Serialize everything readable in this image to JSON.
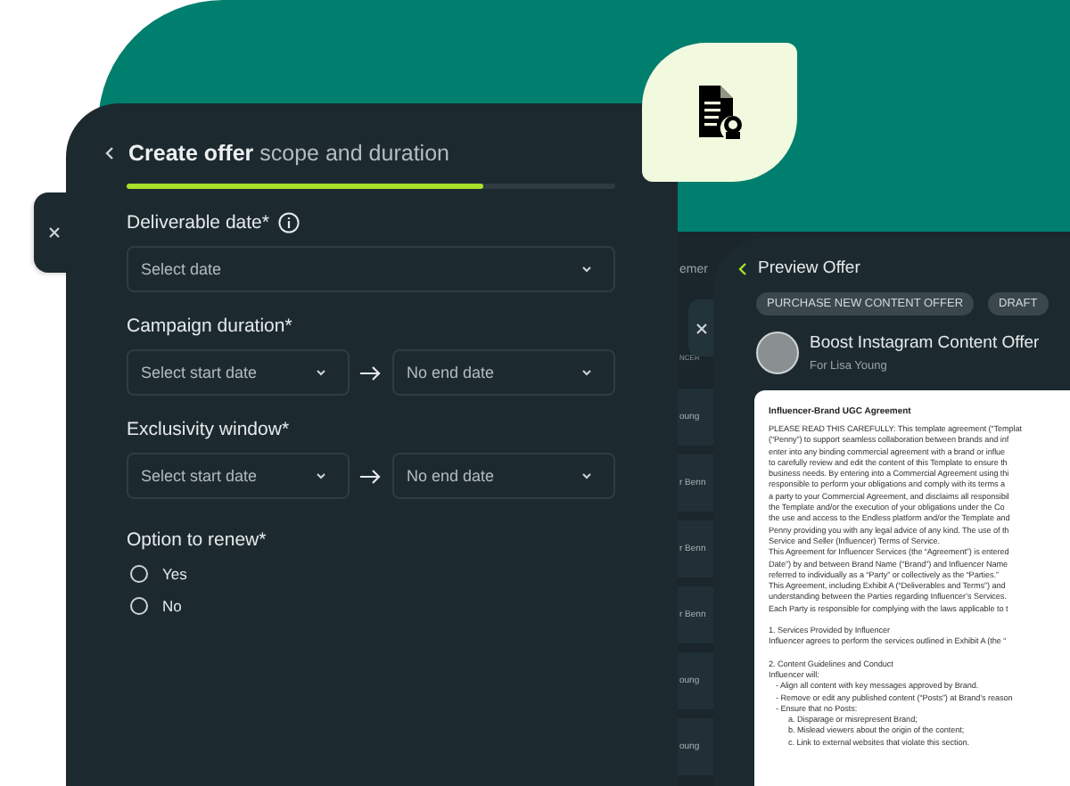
{
  "back_list": {
    "header": "emer",
    "column": "NCER",
    "rows": [
      "oung",
      "r Benn",
      "r Benn",
      "r Benn",
      "oung",
      "oung"
    ]
  },
  "form": {
    "title": "**Create offer** scope and duration",
    "progress": {
      "level": 0.73
    },
    "fields": [
      {
        "kind": "single",
        "label": "Deliverable date*",
        "info": true,
        "placeholder": "Select date"
      },
      {
        "kind": "range",
        "label": "Campaign duration*",
        "info": false,
        "start_placeholder": "Select start date",
        "end_placeholder": "No end date"
      },
      {
        "kind": "range",
        "label": "Exclusivity window*",
        "info": false,
        "start_placeholder": "Select start date",
        "end_placeholder": "No end date"
      }
    ],
    "renew": {
      "label": "Option to renew*",
      "options": [
        {
          "label": "Yes",
          "selected": false
        },
        {
          "label": "No",
          "selected": false
        }
      ]
    }
  },
  "preview": {
    "title": "Preview Offer",
    "tags": [
      "PURCHASE NEW CONTENT OFFER",
      "DRAFT"
    ],
    "offer_title": "Boost Instagram Content Offer",
    "offer_for": "For Lisa Young",
    "document": {
      "title": "Influencer-Brand UGC Agreement",
      "lines": [
        {
          "kind": "line",
          "text": "PLEASE READ THIS CAREFULLY: This template agreement (“Templat"
        },
        {
          "kind": "line",
          "text": "(“Penny”) to support seamless collaboration between brands and inf"
        },
        {
          "kind": "line",
          "text": "enter into any binding commercial agreement with a brand or influe"
        },
        {
          "kind": "line",
          "text": "to carefully review and edit the content of this Template to ensure th"
        },
        {
          "kind": "line",
          "text": "business needs. By entering into a Commercial Agreement using thi"
        },
        {
          "kind": "line",
          "text": "responsible to perform your obligations and comply with its terms a"
        },
        {
          "kind": "line",
          "text": "a party to your Commercial Agreement, and disclaims all responsibil"
        },
        {
          "kind": "line",
          "text": "the Template and/or the execution of your obligations under the Co"
        },
        {
          "kind": "line",
          "text": "the use and access to the Endless platform and/or the Template and"
        },
        {
          "kind": "line",
          "text": "Penny providing you with any legal advice of any kind.  The use of th"
        },
        {
          "kind": "line",
          "text": "Service and Seller (Influencer) Terms of Service."
        },
        {
          "kind": "line",
          "text": "This Agreement for Influencer Services (the “Agreement”) is entered"
        },
        {
          "kind": "line",
          "text": "Date”) by and between Brand Name (“Brand”) and Influencer Name"
        },
        {
          "kind": "line",
          "text": "referred to individually as a “Party” or collectively as the “Parties.”"
        },
        {
          "kind": "line",
          "text": "This Agreement, including Exhibit A (“Deliverables and Terms”) and"
        },
        {
          "kind": "line",
          "text": "understanding between the Parties regarding Influencer’s Services."
        },
        {
          "kind": "line",
          "text": "Each Party is responsible for complying with the laws applicable to t"
        },
        {
          "kind": "section",
          "text": "1. Services Provided by Influencer"
        },
        {
          "kind": "line",
          "text": "Influencer agrees to perform the services outlined in Exhibit A (the “"
        },
        {
          "kind": "section",
          "text": "2. Content Guidelines and Conduct"
        },
        {
          "kind": "line",
          "text": "Influencer will:"
        },
        {
          "kind": "bullet",
          "text": "- Align all content with key messages approved by Brand."
        },
        {
          "kind": "bullet",
          "text": "- Remove or edit any published content (“Posts”) at Brand’s reason"
        },
        {
          "kind": "bullet",
          "text": "- Ensure that no Posts:"
        },
        {
          "kind": "subitem",
          "text": "a. Disparage or misrepresent Brand;"
        },
        {
          "kind": "subitem",
          "text": "b. Mislead viewers about the origin of the content;"
        },
        {
          "kind": "subitem",
          "text": "c. Link to external websites that violate this section."
        }
      ]
    }
  }
}
